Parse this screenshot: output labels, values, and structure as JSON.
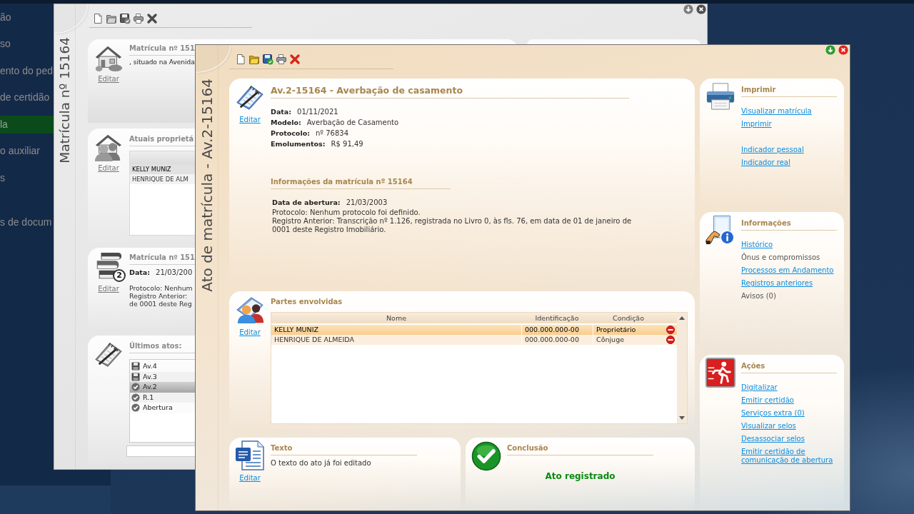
{
  "sidebar": {
    "sections": [
      {
        "items": [
          {
            "label": "ão",
            "selected": false
          },
          {
            "label": "so",
            "selected": false
          },
          {
            "label": "ento do ped",
            "selected": false
          },
          {
            "label": "de certidão",
            "selected": false
          },
          {
            "label": "la",
            "selected": true
          },
          {
            "label": "o auxiliar",
            "selected": false
          },
          {
            "label": "s",
            "selected": false
          }
        ]
      },
      {
        "items": [
          {
            "label": "s de docum",
            "selected": false
          }
        ]
      }
    ]
  },
  "windows": [
    {
      "kind": "registry",
      "title": "Matrícula nº 15164",
      "active": false,
      "cards": [
        {
          "kind": "property",
          "title": "Matrícula nº 151",
          "text": ", situado na Avenida",
          "link": "Editar"
        },
        {
          "kind": "owners",
          "title": "Atuais proprietá",
          "link": "Editar",
          "rows": [
            {
              "name": "KELLY MUNIZ",
              "selected": true
            },
            {
              "name": "HENRIQUE DE ALM",
              "selected": false
            }
          ]
        },
        {
          "kind": "registration",
          "title": "Matrícula nº 151",
          "badge": "2",
          "link": "Editar",
          "fields": [
            {
              "label": "Data:",
              "value": "21/03/200"
            }
          ],
          "lines": [
            "Protocolo: Nenhum",
            "Registro Anterior:",
            "de 0001 deste Reg"
          ]
        },
        {
          "kind": "acts",
          "title": "Últimos atos:",
          "acts": [
            {
              "label": "Av.4",
              "registered": false,
              "selected": false
            },
            {
              "label": "Av.3",
              "registered": false,
              "selected": false
            },
            {
              "label": "Av.2",
              "registered": true,
              "selected": true
            },
            {
              "label": "R.1",
              "registered": true,
              "selected": false
            },
            {
              "label": "Abertura",
              "registered": true,
              "selected": false
            }
          ]
        }
      ]
    },
    {
      "kind": "act",
      "title": "Ato de matrícula - Av.2-15164",
      "active": true,
      "act": {
        "title": "Av.2-15164 - Averbação de casamento",
        "link": "Editar",
        "fields": [
          {
            "label": "Data:",
            "value": "01/11/2021"
          },
          {
            "label": "Modelo:",
            "value": "Averbação de Casamento"
          },
          {
            "label": "Protocolo:",
            "value": "nº 76834"
          },
          {
            "label": "Emolumentos:",
            "value": "R$ 91,49"
          }
        ],
        "registration": {
          "title": "Informações da matrícula nº 15164",
          "fields": [
            {
              "label": "Data de abertura:",
              "value": "21/03/2003"
            }
          ],
          "lines": [
            "Protocolo: Nenhum protocolo foi definido.",
            "Registro Anterior: Transcrição nº 1.126, registrada no Livro 0, às fls. 76, em data de 01 de janeiro de 0001 deste Registro Imobiliário."
          ]
        }
      },
      "parties": {
        "title": "Partes envolvidas",
        "link": "Editar",
        "columns": [
          "Nome",
          "Identificação",
          "Condição"
        ],
        "rows": [
          {
            "name": "KELLY MUNIZ",
            "id": "000.000.000-00",
            "condition": "Proprietário",
            "selected": true
          },
          {
            "name": "HENRIQUE DE ALMEIDA",
            "id": "000.000.000-00",
            "condition": "Cônjuge",
            "selected": false
          }
        ]
      },
      "text_panel": {
        "title": "Texto",
        "text": "O texto do ato já foi editado",
        "link": "Editar"
      },
      "conclusion": {
        "title": "Conclusão",
        "status": "Ato registrado"
      },
      "side_panels": [
        {
          "kind": "print",
          "title": "Imprimir",
          "groups": [
            {
              "links": [
                {
                  "label": "Visualizar matrícula",
                  "disabled": false
                },
                {
                  "label": "Imprimir",
                  "disabled": false
                }
              ]
            },
            {
              "links": [
                {
                  "label": "Indicador pessoal",
                  "disabled": false
                },
                {
                  "label": "Indicador real",
                  "disabled": false
                }
              ]
            }
          ]
        },
        {
          "kind": "info",
          "title": "Informações",
          "groups": [
            {
              "links": [
                {
                  "label": "Histórico",
                  "disabled": false
                },
                {
                  "label": "Ônus e compromissos",
                  "disabled": true
                },
                {
                  "label": "Processos em Andamento",
                  "disabled": false
                },
                {
                  "label": "Registros anteriores",
                  "disabled": false
                },
                {
                  "label": "Avisos (0)",
                  "disabled": true
                }
              ]
            }
          ]
        },
        {
          "kind": "actions",
          "title": "Ações",
          "groups": [
            {
              "links": [
                {
                  "label": "Digitalizar",
                  "disabled": false
                },
                {
                  "label": "Emitir certidão",
                  "disabled": false
                },
                {
                  "label": "Serviços extra (0)",
                  "disabled": false
                },
                {
                  "label": "Visualizar selos",
                  "disabled": false
                },
                {
                  "label": "Desassociar selos",
                  "disabled": false
                },
                {
                  "label": "Emitir certidão de comunicação de abertura",
                  "disabled": false
                }
              ]
            }
          ]
        }
      ]
    }
  ]
}
